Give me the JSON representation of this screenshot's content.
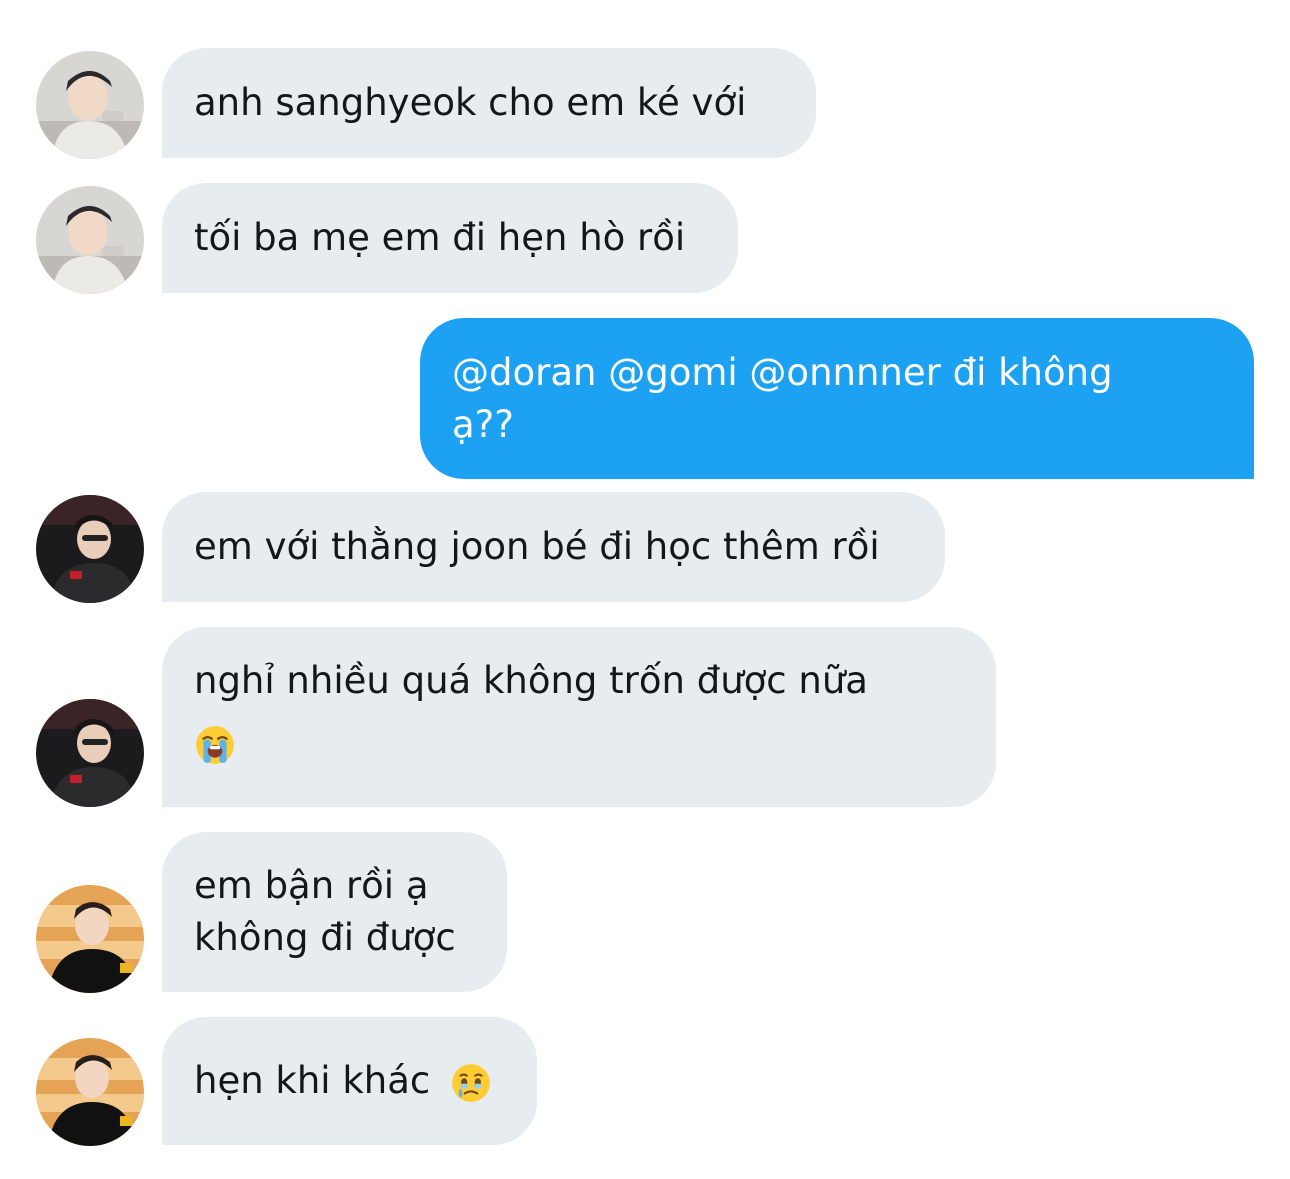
{
  "messages": [
    {
      "sender": "faker",
      "direction": "incoming",
      "lines": [
        "anh sanghyeok cho em ké với"
      ]
    },
    {
      "sender": "faker",
      "direction": "incoming",
      "lines": [
        "tối ba mẹ em đi hẹn hò rồi"
      ]
    },
    {
      "sender": "me",
      "direction": "outgoing",
      "lines": [
        "@doran @gomi @onnnner đi không",
        "ạ??"
      ]
    },
    {
      "sender": "member-2",
      "direction": "incoming",
      "lines": [
        "em với thằng joon bé đi học thêm rồi"
      ]
    },
    {
      "sender": "member-2",
      "direction": "incoming",
      "lines": [
        "nghỉ nhiều quá không trốn được nữa"
      ],
      "emoji": "loudly-crying-face"
    },
    {
      "sender": "member-3",
      "direction": "incoming",
      "lines": [
        "em bận rồi ạ",
        "không đi được"
      ]
    },
    {
      "sender": "member-3",
      "direction": "incoming",
      "lines": [
        "hẹn khi khác"
      ],
      "emoji": "face-holding-back-tears"
    }
  ],
  "colors": {
    "incoming_bubble": "#e6ecf0",
    "outgoing_bubble": "#1da1f2",
    "incoming_text": "#14171a",
    "outgoing_text": "#ffffff"
  }
}
